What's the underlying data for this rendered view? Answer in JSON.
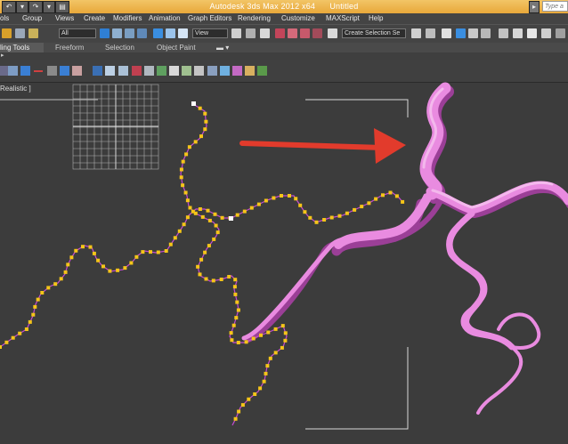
{
  "window": {
    "app_title": "Autodesk 3ds Max  2012 x64",
    "doc_title": "Untitled",
    "help_search_placeholder": "Type a k"
  },
  "menu": [
    "ols",
    "Group",
    "Views",
    "Create",
    "Modifiers",
    "Animation",
    "Graph Editors",
    "Rendering",
    "Customize",
    "MAXScript",
    "Help"
  ],
  "toolbar": {
    "filter_value": "All",
    "refcoord_value": "View",
    "selection_set_value": "Create Selection Se"
  },
  "ribbon_tabs": [
    "ling Tools",
    "Freeform",
    "Selection",
    "Object Paint"
  ],
  "viewport": {
    "label": "Realistic ]"
  },
  "colors": {
    "title_bar": "#e8a83a",
    "spline_vertex": "#f5c518",
    "spline_curve": "#c44bd1",
    "river_mesh": "#e98be0",
    "arrow": "#e23b2c",
    "viewport_bg": "#3c3c3c"
  },
  "icons": {
    "arrow": "red-arrow-annotation",
    "grid": "grid-gizmo"
  }
}
